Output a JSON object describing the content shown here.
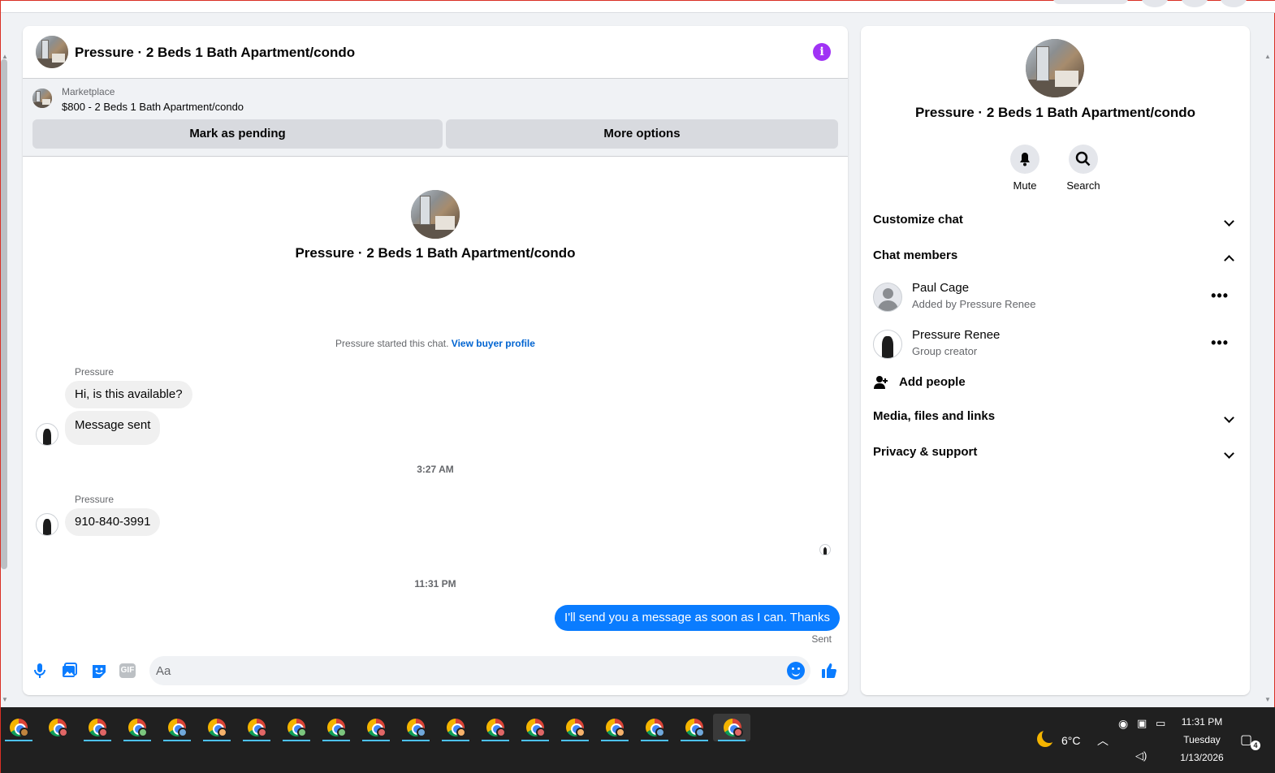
{
  "chat": {
    "title": "Pressure · 2 Beds 1 Bath Apartment/condo",
    "marketplace_label": "Marketplace",
    "listing": "$800 - 2 Beds 1 Bath Apartment/condo",
    "mark_pending": "Mark as pending",
    "more_options": "More options",
    "center_title": "Pressure · 2 Beds 1 Bath Apartment/condo",
    "started_text": "Pressure started this chat.",
    "view_buyer_profile": "View buyer profile",
    "messages": {
      "group1_sender": "Pressure",
      "msg1": "Hi, is this available?",
      "msg2": "Message sent",
      "ts1": "3:27 AM",
      "group2_sender": "Pressure",
      "msg3": "910-840-3991",
      "ts2": "11:31 PM",
      "sent_msg": "I'll send you a message as soon as I can. Thanks",
      "sent_status": "Sent"
    },
    "composer": {
      "placeholder": "Aa",
      "icons": [
        "microphone-icon",
        "photo-icon",
        "sticker-icon",
        "gif-icon",
        "emoji-icon",
        "like-icon"
      ],
      "gif_label": "GIF"
    }
  },
  "side": {
    "title": "Pressure · 2 Beds 1 Bath Apartment/condo",
    "mute_label": "Mute",
    "search_label": "Search",
    "customize_chat": "Customize chat",
    "chat_members": "Chat members",
    "members": [
      {
        "name": "Paul Cage",
        "sub": "Added by Pressure Renee"
      },
      {
        "name": "Pressure Renee",
        "sub": "Group creator"
      }
    ],
    "add_people": "Add people",
    "media": "Media, files and links",
    "privacy": "Privacy & support"
  },
  "taskbar": {
    "weather": "6°C",
    "time": "11:31 PM",
    "day": "Tuesday",
    "date": "1/13/2026",
    "notifications": "4"
  },
  "colors": {
    "accent": "#0a7cff",
    "info": "#a033f5",
    "link": "#0064d1"
  }
}
